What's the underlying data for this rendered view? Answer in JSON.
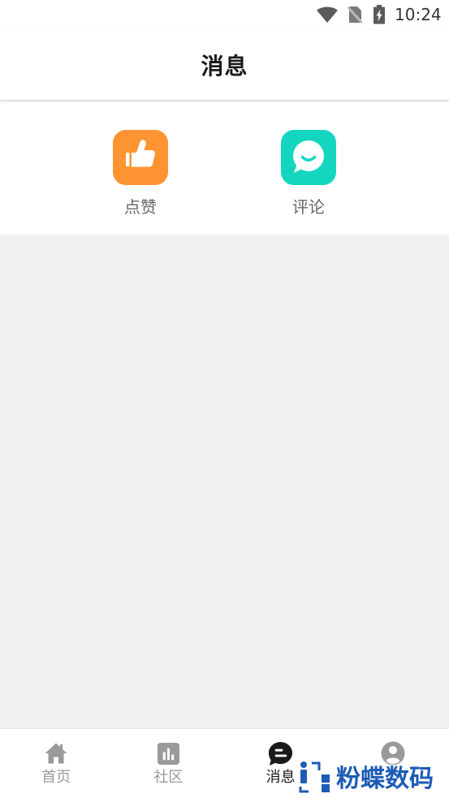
{
  "status_bar": {
    "time": "10:24",
    "icons": [
      "wifi-icon",
      "no-sim-icon",
      "battery-charging-icon"
    ]
  },
  "header": {
    "title": "消息"
  },
  "message_types": [
    {
      "label": "点赞",
      "icon": "thumbs-up-icon",
      "color": "#FE9431"
    },
    {
      "label": "评论",
      "icon": "comment-bubble-icon",
      "color": "#14D6BF"
    }
  ],
  "tab_bar": {
    "tabs": [
      {
        "label": "首页",
        "icon": "home-icon",
        "active": false
      },
      {
        "label": "社区",
        "icon": "community-chart-icon",
        "active": false
      },
      {
        "label": "消息",
        "icon": "message-icon",
        "active": true
      },
      {
        "icon": "user-icon",
        "active": false
      }
    ]
  },
  "colors": {
    "page_background": "#F1F1F1",
    "tab_active": "#1A1A1A",
    "tab_inactive": "#9A9A9A",
    "watermark": "#1D5CB5"
  },
  "watermark": {
    "text": "粉蝶数码",
    "icon": "watermark-logo-icon"
  }
}
